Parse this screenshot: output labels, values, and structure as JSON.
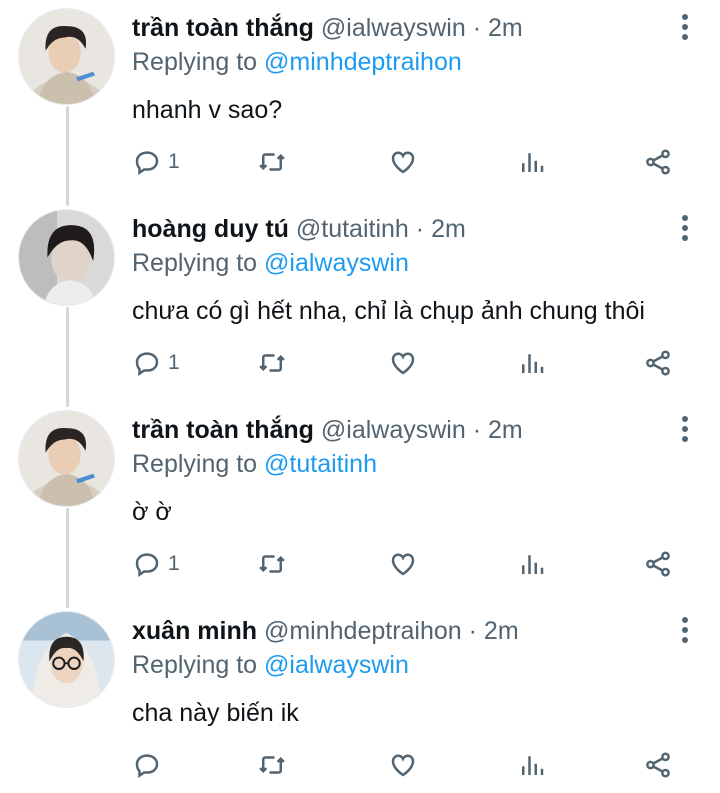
{
  "tweets": [
    {
      "name": "trần toàn thắng",
      "handle": "@ialwayswin",
      "separator": "·",
      "time": "2m",
      "replying_prefix": "Replying to",
      "replying_to": "@minhdeptraihon",
      "text": "nhanh v sao?",
      "reply_count": "1"
    },
    {
      "name": "hoàng duy tú",
      "handle": "@tutaitinh",
      "separator": "·",
      "time": "2m",
      "replying_prefix": "Replying to",
      "replying_to": "@ialwayswin",
      "text": "chưa có gì hết nha, chỉ là chụp ảnh chung thôi",
      "reply_count": "1"
    },
    {
      "name": "trần toàn thắng",
      "handle": "@ialwayswin",
      "separator": "·",
      "time": "2m",
      "replying_prefix": "Replying to",
      "replying_to": "@tutaitinh",
      "text": "ờ ờ",
      "reply_count": "1"
    },
    {
      "name": "xuân minh",
      "handle": "@minhdeptraihon",
      "separator": "·",
      "time": "2m",
      "replying_prefix": "Replying to",
      "replying_to": "@ialwayswin",
      "text": "cha này biến ik",
      "reply_count": ""
    }
  ],
  "icons": {
    "reply": "reply-icon",
    "retweet": "retweet-icon",
    "like": "heart-icon",
    "stats": "stats-icon",
    "share": "share-icon",
    "more": "more-vertical-icon"
  },
  "colors": {
    "mention": "#1d9bf0",
    "secondary_text": "#536471",
    "thread_line": "#cfd9de"
  }
}
